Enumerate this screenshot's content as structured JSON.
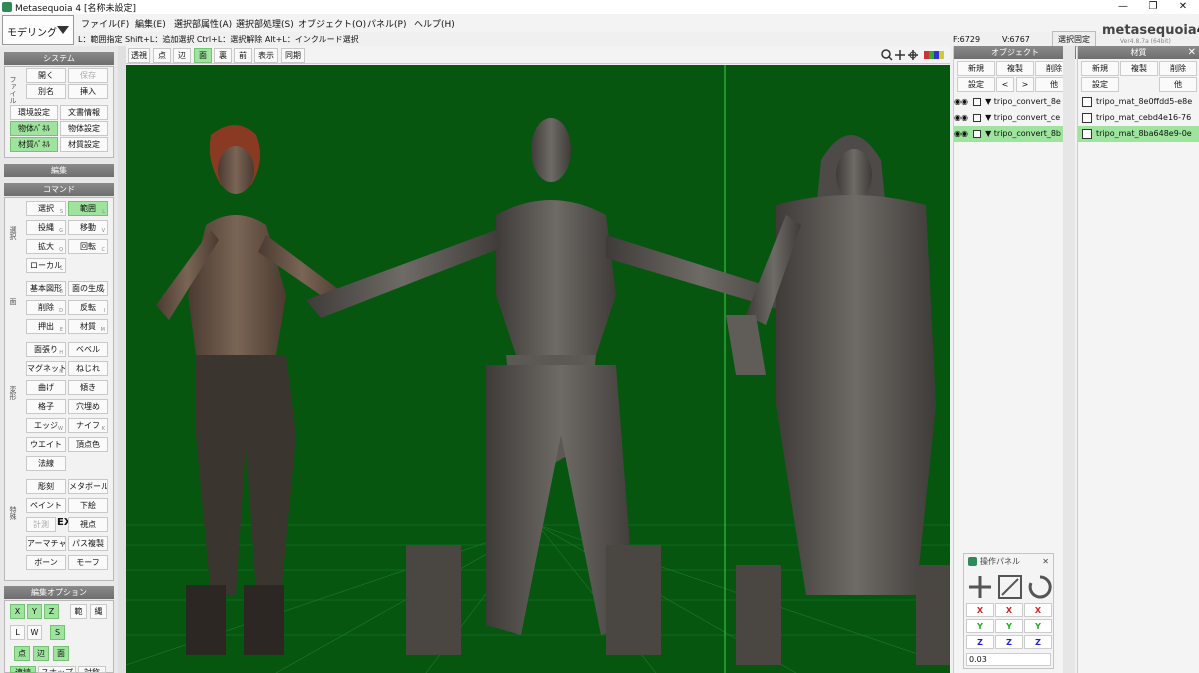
{
  "window": {
    "title": "Metasequoia 4 [名称未設定]",
    "minimize": "—",
    "maximize": "❐",
    "close": "✕"
  },
  "mode": {
    "selected": "モデリング"
  },
  "menu": [
    "ファイル(F)",
    "編集(E)",
    "選択部属性(A)",
    "選択部処理(S)",
    "オブジェクト(O)",
    "パネル(P)",
    "ヘルプ(H)"
  ],
  "hint": "L：範囲指定 Shift+L：追加選択 Ctrl+L：選択解除 Alt+L：インクルード選択",
  "status": {
    "faces": "F:6729",
    "vertices": "V:6767",
    "fix_label": "選択固定"
  },
  "logo": {
    "text": "metasequoia",
    "version_digit": "4",
    "sub": "Ver4.8.7a (64bit)"
  },
  "system": {
    "header": "システム",
    "side_label": "ファイル",
    "buttons": [
      "開く",
      "保存",
      "別名",
      "挿入",
      "環境設定",
      "文書情報",
      "物体ﾊﾟﾈﾙ",
      "物体設定",
      "材質ﾊﾟﾈﾙ",
      "材質設定"
    ]
  },
  "edit_header": "編集",
  "command": {
    "header": "コマンド",
    "groups": [
      "選択",
      "面",
      "変形",
      "特殊"
    ],
    "buttons": [
      {
        "label": "選択",
        "sub": "S"
      },
      {
        "label": "範囲",
        "sub": "L"
      },
      {
        "label": "投縄",
        "sub": "G"
      },
      {
        "label": "移動",
        "sub": "V"
      },
      {
        "label": "拡大",
        "sub": "Q"
      },
      {
        "label": "回転",
        "sub": "C"
      },
      {
        "label": "ローカル",
        "sub": "L"
      },
      {
        "label": "基本図形",
        "sub": "B"
      },
      {
        "label": "面の生成",
        "sub": "T"
      },
      {
        "label": "削除",
        "sub": "D"
      },
      {
        "label": "反転",
        "sub": "I"
      },
      {
        "label": "押出",
        "sub": "E"
      },
      {
        "label": "材質",
        "sub": "M"
      },
      {
        "label": "面張り",
        "sub": "H"
      },
      {
        "label": "ベベル",
        "sub": ""
      },
      {
        "label": "マグネット",
        "sub": "N"
      },
      {
        "label": "ねじれ",
        "sub": ""
      },
      {
        "label": "曲げ",
        "sub": ""
      },
      {
        "label": "傾き",
        "sub": ""
      },
      {
        "label": "格子",
        "sub": ""
      },
      {
        "label": "穴埋め",
        "sub": ""
      },
      {
        "label": "エッジ",
        "sub": "W"
      },
      {
        "label": "ナイフ",
        "sub": "K"
      },
      {
        "label": "ウエイト",
        "sub": ""
      },
      {
        "label": "頂点色",
        "sub": ""
      },
      {
        "label": "法線",
        "sub": ""
      },
      {
        "label": "彫刻",
        "sub": ""
      },
      {
        "label": "メタボール",
        "sub": ""
      },
      {
        "label": "ペイント",
        "sub": ""
      },
      {
        "label": "下絵",
        "sub": ""
      },
      {
        "label": "計測",
        "sub": ""
      },
      {
        "label": "EX",
        "sub": ""
      },
      {
        "label": "視点",
        "sub": ""
      },
      {
        "label": "アーマチャー",
        "sub": ""
      },
      {
        "label": "パス複製",
        "sub": ""
      },
      {
        "label": "ボーン",
        "sub": ""
      },
      {
        "label": "モーフ",
        "sub": ""
      }
    ]
  },
  "edit_options": {
    "header": "編集オプション",
    "axes": [
      "X",
      "Y",
      "Z"
    ],
    "range": "範",
    "cont": "縄",
    "space": [
      "L",
      "W",
      "S"
    ],
    "targets": [
      "点",
      "辺",
      "面"
    ],
    "bottom": [
      "連続",
      "スナップ",
      "対称"
    ]
  },
  "view_toolbar": [
    "透視",
    "点",
    "辺",
    "面",
    "裏",
    "前",
    "表示",
    "同期"
  ],
  "objects": {
    "header": "オブジェクト",
    "buttons": [
      "新規",
      "複製",
      "削除",
      "設定",
      "<",
      ">",
      "他"
    ],
    "items": [
      "tripo_convert_8e",
      "tripo_convert_ce",
      "tripo_convert_8b"
    ]
  },
  "materials": {
    "header": "材質",
    "buttons": [
      "新規",
      "複製",
      "削除",
      "設定",
      "他"
    ],
    "items": [
      "tripo_mat_8e0ffdd5-e8e",
      "tripo_mat_cebd4e16-76",
      "tripo_mat_8ba648e9-0e"
    ]
  },
  "op_panel": {
    "title": "操作パネル",
    "x": "X",
    "y": "Y",
    "z": "Z",
    "value": "0.03"
  },
  "colors": {
    "viewport_bg": "#06560f",
    "grid": "#2a8a3a",
    "selected": "#9ee39e"
  }
}
